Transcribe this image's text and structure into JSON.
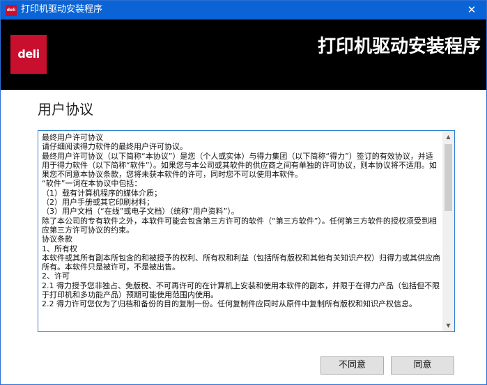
{
  "window": {
    "title": "打印机驱动安装程序",
    "close_glyph": "✕"
  },
  "banner": {
    "logo_text": "deli",
    "title": "打印机驱动安装程序",
    "background": "#000000",
    "logo_color": "#c8102e"
  },
  "page": {
    "section_title": "用户协议"
  },
  "license": {
    "text": "最终用户许可协议\n请仔细阅读得力软件的最终用户许可协议。\n最终用户许可协议（以下简称“本协议”）是您（个人或实体）与得力集团（以下简称“得力”）签订的有效协议，并适用于得力软件（以下简称“软件”）。如果您与本公司或其软件的供应商之间有单独的许可协议，则本协议将不适用。如果您不同意本协议条款，您将未获本软件的许可，同时您不可以使用本软件。\n“软件”一词在本协议中包括：\n（1）载有计算机程序的媒体介质；\n（2）用户手册或其它印刷材料；\n（3）用户文档（“在线”或电子文档）（统称“用户资料”）。\n除了本公司的专有软件之外，本软件可能会包含第三方许可的软件（“第三方软件”）。任何第三方软件的授权须受到相应第三方许可协议的约束。\n协议条款\n1、所有权\n本软件或其所有副本所包含的和被授予的权利、所有权和利益（包括所有版权和其他有关知识产权）归得力或其供应商所有。本软件只是被许可，不是被出售。\n2、许可\n2.1 得力授予您非独占、免版税、不可再许可的在计算机上安装和使用本软件的副本，并限于在得力产品（包括但不限于打印机和多功能产品）预期可能使用范围内使用。\n2.2 得力许可您仅为了归档和备份的目的复制一份。任何复制件应同时从原件中复制所有版权和知识产权信息。"
  },
  "buttons": {
    "disagree": "不同意",
    "agree": "同意"
  },
  "colors": {
    "titlebar": "#0a64d6",
    "accent_border": "#2f7fd1"
  }
}
